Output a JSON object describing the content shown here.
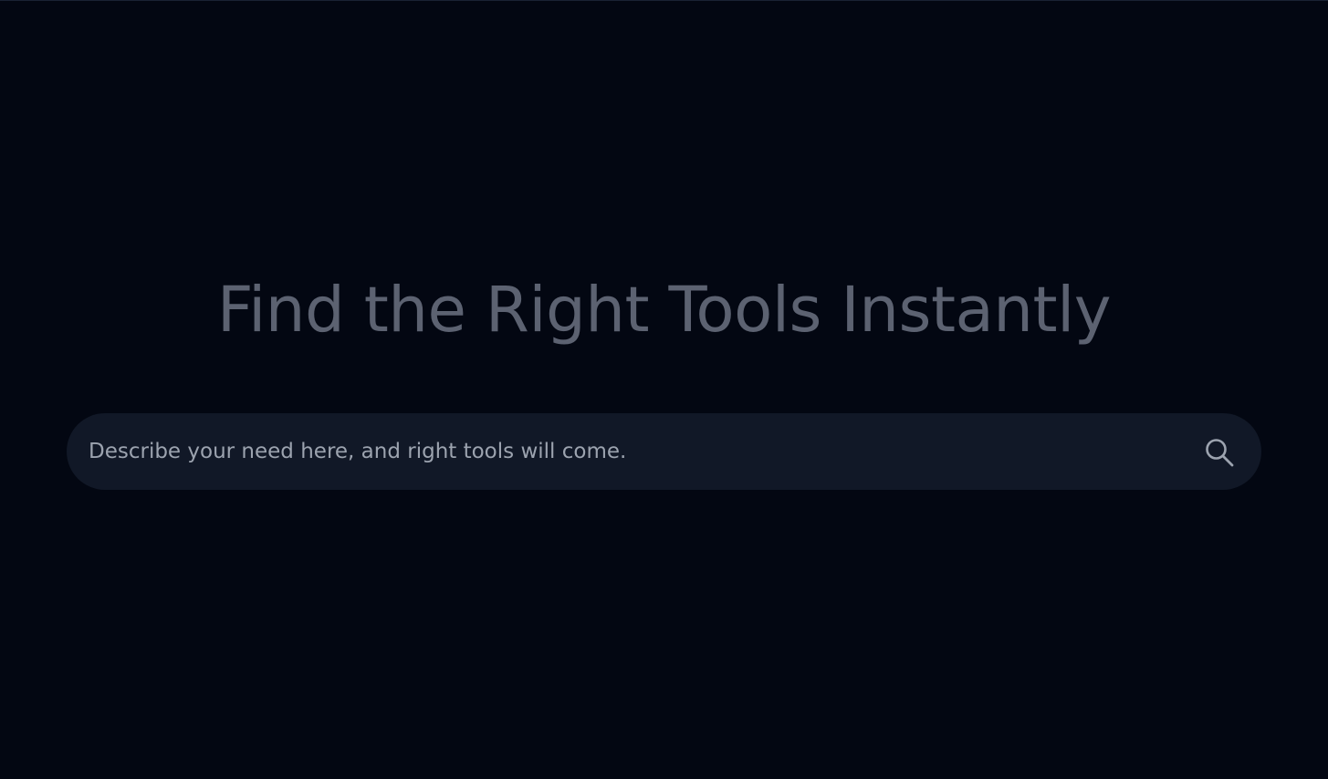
{
  "hero": {
    "title": "Find the Right Tools Instantly"
  },
  "search": {
    "placeholder": "Describe your need here, and right tools will come.",
    "value": "",
    "icon": "search-icon"
  },
  "colors": {
    "background": "#030712",
    "search_bar": "#111827",
    "title_text": "#5c6271",
    "placeholder_text": "#9ca3af",
    "icon": "#9ca3af"
  }
}
